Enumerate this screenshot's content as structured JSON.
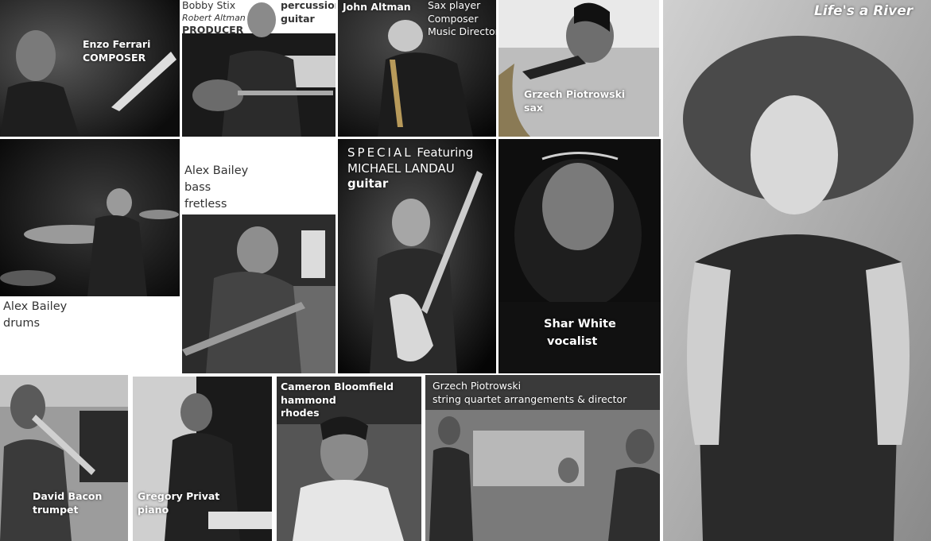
{
  "colors": {
    "page": "#ffffff",
    "caption": "#ffffff",
    "caption_dark": "#333333"
  },
  "tiles": {
    "enzo": {
      "name": "Enzo Ferrari",
      "role": "COMPOSER"
    },
    "bobby": {
      "name": "Bobby Stix",
      "alias": "Robert Altman",
      "role": "PRODUCER",
      "instrument_1": "percussion",
      "instrument_2": "guitar"
    },
    "john": {
      "name": "John Altman",
      "role_1": "Sax player",
      "role_2": "Composer",
      "role_3": "Music Director"
    },
    "grzech_sax": {
      "name": "Grzech Piotrowski",
      "role": "sax"
    },
    "alex_drums": {
      "name": "Alex Bailey",
      "role": "drums"
    },
    "alex_bass": {
      "name": "Alex Bailey",
      "role_1": "bass",
      "role_2": "fretless"
    },
    "landau": {
      "special": "SPECIAL",
      "featuring": "Featuring",
      "name": "MICHAEL LANDAU",
      "role": "guitar"
    },
    "shar": {
      "name": "Shar White",
      "role": "vocalist"
    },
    "poster": {
      "title": "Life's a River"
    },
    "david": {
      "name": "David Bacon",
      "role": "trumpet"
    },
    "gregory": {
      "name": "Gregory Privat",
      "role": "piano"
    },
    "cameron": {
      "name": "Cameron Bloomfield",
      "role_1": "hammond",
      "role_2": "rhodes"
    },
    "grzech_str": {
      "name": "Grzech Piotrowski",
      "role": "string quartet arrangements & director"
    }
  }
}
